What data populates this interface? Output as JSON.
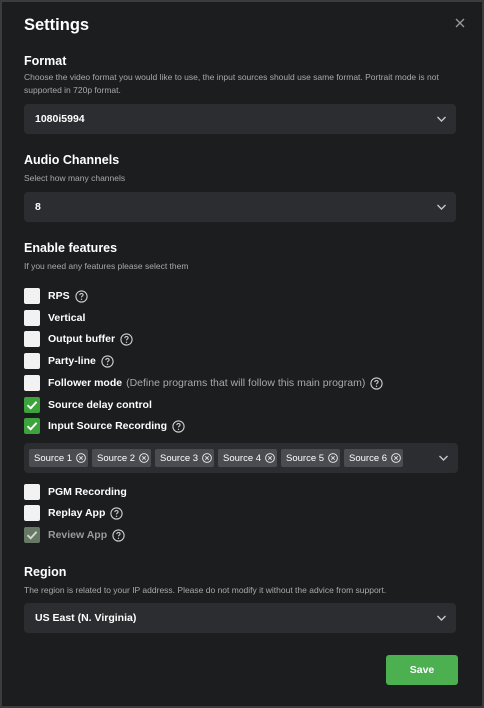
{
  "dialog": {
    "title": "Settings"
  },
  "format": {
    "title": "Format",
    "description": "Choose the video format you would like to use, the input sources should use same format. Portrait mode is not supported in 720p format.",
    "value": "1080i5994"
  },
  "audio": {
    "title": "Audio Channels",
    "description": "Select how many channels",
    "value": "8"
  },
  "features": {
    "title": "Enable features",
    "description": "If you need any features please select them",
    "items": [
      {
        "label": "RPS",
        "checked": false,
        "help": true
      },
      {
        "label": "Vertical",
        "checked": false,
        "help": false
      },
      {
        "label": "Output buffer",
        "checked": false,
        "help": true
      },
      {
        "label": "Party-line",
        "checked": false,
        "help": true
      },
      {
        "label": "Follower mode",
        "extra": "(Define programs that will follow this main program)",
        "checked": false,
        "help": true
      },
      {
        "label": "Source delay control",
        "checked": true,
        "help": false
      },
      {
        "label": "Input Source Recording",
        "checked": true,
        "help": true
      }
    ],
    "sources": [
      "Source 1",
      "Source 2",
      "Source 3",
      "Source 4",
      "Source 5",
      "Source 6"
    ],
    "items_after": [
      {
        "label": "PGM Recording",
        "checked": false,
        "help": false
      },
      {
        "label": "Replay App",
        "checked": false,
        "help": true
      },
      {
        "label": "Review App",
        "checked": true,
        "disabled": true,
        "help": true
      }
    ]
  },
  "region": {
    "title": "Region",
    "description": "The region is related to your IP address. Please do not modify it without the advice from support.",
    "value": "US East (N. Virginia)"
  },
  "footer": {
    "save_label": "Save"
  },
  "colors": {
    "background": "#1c1d1f",
    "field": "#2b2d30",
    "accent_green": "#4caf50",
    "checked_green": "#3da43d",
    "muted_text": "#a9a9a9"
  }
}
